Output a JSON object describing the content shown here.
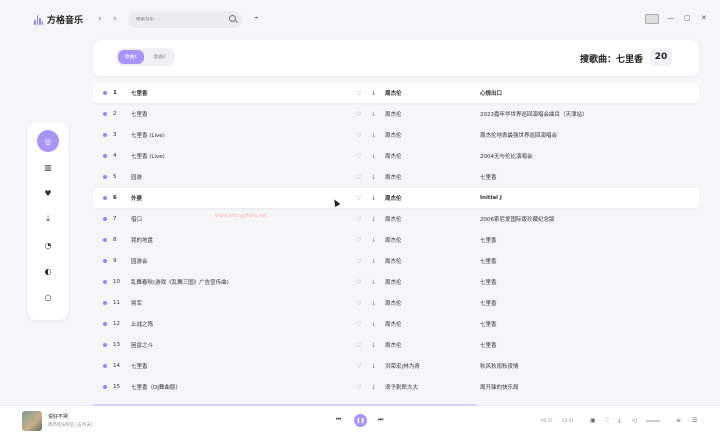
{
  "app": {
    "title": "方格音乐"
  },
  "search": {
    "placeholder": "搜索音乐"
  },
  "tabs": [
    {
      "label": "歌曲1",
      "active": true
    },
    {
      "label": "歌曲2",
      "active": false
    }
  ],
  "header": {
    "search_label": "搜歌曲：七里香",
    "count": "20"
  },
  "songs": [
    {
      "num": "1",
      "title": "七里香",
      "artist": "周杰伦",
      "album": "心情出口",
      "highlight": true
    },
    {
      "num": "2",
      "title": "七里香",
      "artist": "周杰伦",
      "album": "2023嘉年华世界巡回演唱会曲目（天津站）",
      "highlight": false
    },
    {
      "num": "3",
      "title": "七里香 (Live)",
      "artist": "周杰伦",
      "album": "周杰伦地表最强世界巡回演唱会",
      "highlight": false
    },
    {
      "num": "4",
      "title": "七里香 (Live)",
      "artist": "周杰伦",
      "album": "2004无与伦比演唱会",
      "highlight": false
    },
    {
      "num": "5",
      "title": "园游",
      "artist": "周杰伦",
      "album": "七里香",
      "highlight": false
    },
    {
      "num": "6",
      "title": "外婆",
      "artist": "周杰伦",
      "album": "Initial J",
      "highlight": true
    },
    {
      "num": "7",
      "title": "借口",
      "artist": "周杰伦",
      "album": "2006索尼爱国际版珍藏纪念版",
      "highlight": false
    },
    {
      "num": "8",
      "title": "我的地盘",
      "artist": "周杰伦",
      "album": "七里香",
      "highlight": false
    },
    {
      "num": "9",
      "title": "园游会",
      "artist": "周杰伦",
      "album": "七里香",
      "highlight": false
    },
    {
      "num": "10",
      "title": "乱舞春秋(游戏《乱舞三国》广告宣传曲)",
      "artist": "周杰伦",
      "album": "七里香",
      "highlight": false
    },
    {
      "num": "11",
      "title": "将军",
      "artist": "周杰伦",
      "album": "七里香",
      "highlight": false
    },
    {
      "num": "12",
      "title": "止战之殇",
      "artist": "周杰伦",
      "album": "七里香",
      "highlight": false
    },
    {
      "num": "13",
      "title": "困兽之斗",
      "artist": "周杰伦",
      "album": "七里香",
      "highlight": false
    },
    {
      "num": "14",
      "title": "七里香",
      "artist": "洪荣宏|林为青",
      "album": "秋风秋雨秋夜情",
      "highlight": false
    },
    {
      "num": "15",
      "title": "七里香（DJ舞曲版）",
      "artist": "浪子刺郎大大",
      "album": "周开锋的快乐局",
      "highlight": false
    }
  ],
  "watermark": "www.xitongzhijia.net",
  "player": {
    "title": "说好不哭",
    "subtitle": "周杰伦&阿信 (五月天)",
    "time_current": "00:37",
    "time_total": "03:42"
  },
  "colors": {
    "accent": "#a995f5",
    "background": "#f6f6f9"
  }
}
